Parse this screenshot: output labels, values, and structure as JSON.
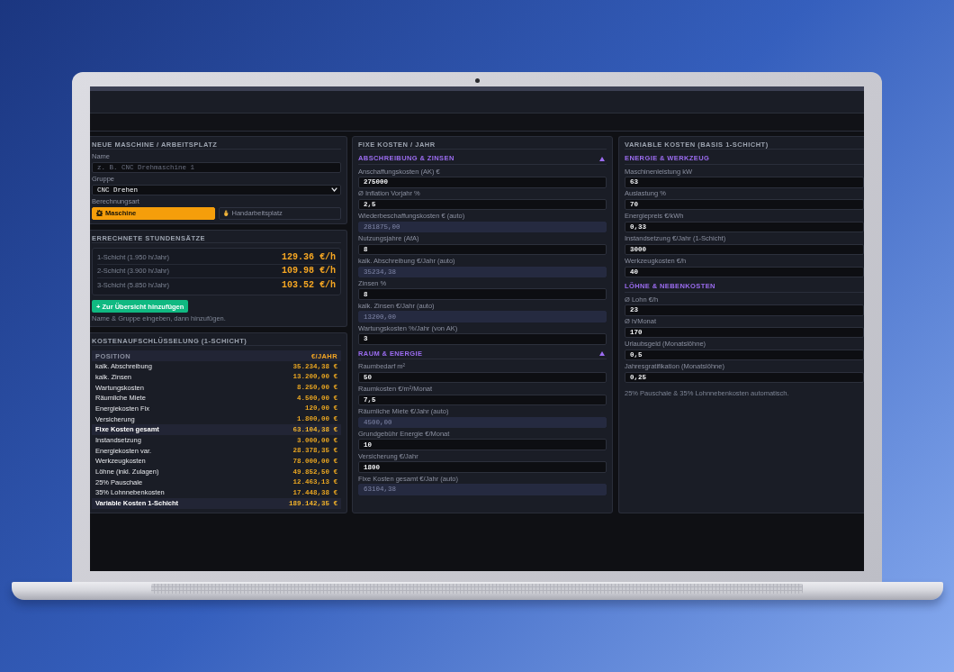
{
  "new_machine": {
    "title": "NEUE MASCHINE / ARBEITSPLATZ",
    "name": {
      "label": "Name",
      "placeholder": "z. B. CNC Drehmaschine 1"
    },
    "group": {
      "label": "Gruppe",
      "value": "CNC Drehen"
    },
    "mode": {
      "label": "Berechnungsart",
      "options": [
        {
          "kind": "machine",
          "label": "Maschine",
          "selected": true
        },
        {
          "kind": "manual",
          "label": "Handarbeitsplatz",
          "selected": false
        }
      ]
    }
  },
  "hourly_rates": {
    "title": "ERRECHNETE STUNDENSÄTZE",
    "rows": [
      {
        "label": "1-Schicht (1.950 h/Jahr)",
        "value": "129.36 €/h"
      },
      {
        "label": "2-Schicht (3.900 h/Jahr)",
        "value": "109.98 €/h"
      },
      {
        "label": "3-Schicht (5.850 h/Jahr)",
        "value": "103.52 €/h"
      }
    ],
    "add_button": "+ Zur Übersicht hinzufügen",
    "hint": "Name & Gruppe eingeben, dann hinzufügen."
  },
  "cost_breakdown": {
    "title": "KOSTENAUFSCHLÜSSELUNG (1-SCHICHT)",
    "columns": [
      "POSITION",
      "€/JAHR"
    ],
    "rows": [
      {
        "kind": "item",
        "label": "kalk. Abschreibung",
        "value": "35.234,38 €"
      },
      {
        "kind": "item",
        "label": "kalk. Zinsen",
        "value": "13.200,00 €"
      },
      {
        "kind": "item",
        "label": "Wartungskosten",
        "value": "8.250,00 €"
      },
      {
        "kind": "item",
        "label": "Räumliche Miete",
        "value": "4.500,00 €"
      },
      {
        "kind": "item",
        "label": "Energiekosten Fix",
        "value": "120,00 €"
      },
      {
        "kind": "item",
        "label": "Versicherung",
        "value": "1.800,00 €"
      },
      {
        "kind": "total",
        "label": "Fixe Kosten gesamt",
        "value": "63.104,38 €"
      },
      {
        "kind": "item",
        "label": "Instandsetzung",
        "value": "3.000,00 €"
      },
      {
        "kind": "item",
        "label": "Energiekosten var.",
        "value": "28.378,35 €"
      },
      {
        "kind": "item",
        "label": "Werkzeugkosten",
        "value": "78.000,00 €"
      },
      {
        "kind": "item",
        "label": "Löhne (inkl. Zulagen)",
        "value": "49.852,50 €"
      },
      {
        "kind": "item",
        "label": "25% Pauschale",
        "value": "12.463,13 €"
      },
      {
        "kind": "item",
        "label": "35% Lohnnebenkosten",
        "value": "17.448,38 €"
      },
      {
        "kind": "total",
        "label": "Variable Kosten 1-Schicht",
        "value": "189.142,35 €"
      }
    ]
  },
  "fixed_costs": {
    "title": "FIXE KOSTEN / JAHR",
    "sections": [
      {
        "title": "ABSCHREIBUNG & ZINSEN",
        "expanded": true,
        "fields": [
          {
            "kind": "input",
            "label": "Anschaffungskosten (AK) €",
            "value": "275000"
          },
          {
            "kind": "input",
            "label": "Ø Inflation Vorjahr %",
            "value": "2,5"
          },
          {
            "kind": "computed",
            "label": "Wiederbeschaffungskosten € (auto)",
            "value": "281875,00"
          },
          {
            "kind": "input",
            "label": "Nutzungsjahre (AfA)",
            "value": "8"
          },
          {
            "kind": "computed",
            "label": "kalk. Abschreibung €/Jahr (auto)",
            "value": "35234,38"
          },
          {
            "kind": "input",
            "label": "Zinsen %",
            "value": "8"
          },
          {
            "kind": "computed",
            "label": "kalk. Zinsen €/Jahr (auto)",
            "value": "13200,00"
          },
          {
            "kind": "input",
            "label": "Wartungskosten %/Jahr (von AK)",
            "value": "3"
          }
        ]
      },
      {
        "title": "RAUM & ENERGIE",
        "expanded": true,
        "fields": [
          {
            "kind": "input",
            "label": "Raumbedarf m²",
            "value": "50"
          },
          {
            "kind": "input",
            "label": "Raumkosten €/m²/Monat",
            "value": "7,5"
          },
          {
            "kind": "computed",
            "label": "Räumliche Miete €/Jahr (auto)",
            "value": "4500,00"
          },
          {
            "kind": "input",
            "label": "Grundgebühr Energie €/Monat",
            "value": "10"
          },
          {
            "kind": "input",
            "label": "Versicherung €/Jahr",
            "value": "1800"
          },
          {
            "kind": "computed",
            "label": "Fixe Kosten gesamt €/Jahr (auto)",
            "value": "63104,38"
          }
        ]
      }
    ]
  },
  "variable_costs": {
    "title": "VARIABLE KOSTEN (BASIS 1-SCHICHT)",
    "sections": [
      {
        "title": "ENERGIE & WERKZEUG",
        "fields": [
          {
            "kind": "input",
            "label": "Maschinenleistung kW",
            "value": "63"
          },
          {
            "kind": "input",
            "label": "Auslastung %",
            "value": "70"
          },
          {
            "kind": "input",
            "label": "Energiepreis €/kWh",
            "value": "0,33"
          },
          {
            "kind": "input",
            "label": "Instandsetzung €/Jahr (1-Schicht)",
            "value": "3000"
          },
          {
            "kind": "input",
            "label": "Werkzeugkosten €/h",
            "value": "40"
          }
        ]
      },
      {
        "title": "LÖHNE & NEBENKOSTEN",
        "fields": [
          {
            "kind": "input",
            "label": "Ø Lohn €/h",
            "value": "23"
          },
          {
            "kind": "input",
            "label": "Ø h/Monat",
            "value": "170"
          },
          {
            "kind": "input",
            "label": "Urlaubsgeld (Monatslöhne)",
            "value": "0,5"
          },
          {
            "kind": "input",
            "label": "Jahresgratifikation (Monatslöhne)",
            "value": "0,25"
          }
        ]
      }
    ],
    "note": "25% Pauschale & 35% Lohnnebenkosten automatisch."
  }
}
